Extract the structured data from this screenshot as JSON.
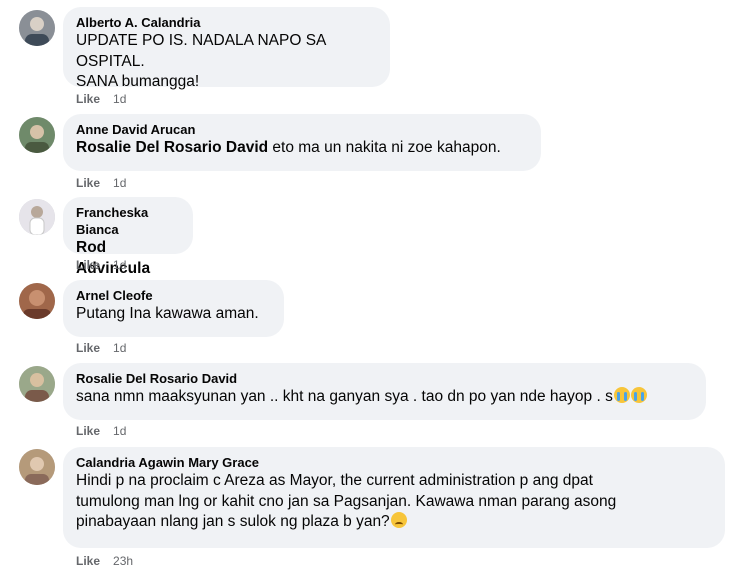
{
  "comments": [
    {
      "author": "Alberto A. Calandria",
      "mention": "",
      "text": "UPDATE PO IS. NADALA NAPO SA OSPITAL.\nSANA bumangga!",
      "like": "Like",
      "time": "1d",
      "avatar_icon": "profile-photo-icon",
      "avatar_color": "#8a8f96"
    },
    {
      "author": "Anne David Arucan",
      "mention": "Rosalie Del Rosario David",
      "text": " eto ma un nakita ni zoe kahapon.",
      "like": "Like",
      "time": "1d",
      "avatar_icon": "profile-photo-icon",
      "avatar_color": "#6f8a6a"
    },
    {
      "author": "Francheska Bianca",
      "mention": "Rod Advincula",
      "text": "",
      "like": "Like",
      "time": "1d",
      "avatar_icon": "profile-photo-icon",
      "avatar_color": "#d8d6dc"
    },
    {
      "author": "Arnel Cleofe",
      "mention": "",
      "text": "Putang Ina kawawa aman.",
      "like": "Like",
      "time": "1d",
      "avatar_icon": "profile-photo-icon",
      "avatar_color": "#a0674a"
    },
    {
      "author": "Rosalie Del Rosario David",
      "mention": "",
      "text": "sana nmn maaksyunan yan .. kht na ganyan sya . tao dn po yan nde hayop . s",
      "like": "Like",
      "time": "1d",
      "avatar_icon": "profile-photo-icon",
      "avatar_color": "#9aa88a"
    },
    {
      "author": "Calandria Agawin Mary Grace",
      "mention": "",
      "text": "Hindi p na proclaim c Areza as Mayor, the current administration p ang dpat\ntumulong man lng or kahit cno jan sa Pagsanjan. Kawawa nman parang asong\npinabayaan nlang jan s sulok ng plaza b yan?",
      "like": "Like",
      "time": "23h",
      "avatar_icon": "profile-photo-icon",
      "avatar_color": "#b59a7a"
    }
  ]
}
